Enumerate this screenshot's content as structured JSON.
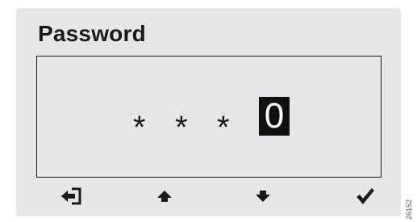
{
  "screen": {
    "title": "Password",
    "entry": {
      "masked": [
        "*",
        "*",
        "*"
      ],
      "active_digit": "0"
    }
  },
  "softkeys": [
    {
      "icon": "exit-icon",
      "label": "Exit"
    },
    {
      "icon": "arrow-up-icon",
      "label": "Up"
    },
    {
      "icon": "arrow-down-icon",
      "label": "Down"
    },
    {
      "icon": "checkmark-icon",
      "label": "OK"
    }
  ],
  "figure_id": "26152",
  "colors": {
    "panel": "#e4e6e8",
    "ink": "#1a1a1a",
    "cursor_bg": "#111111",
    "cursor_fg": "#ffffff"
  }
}
